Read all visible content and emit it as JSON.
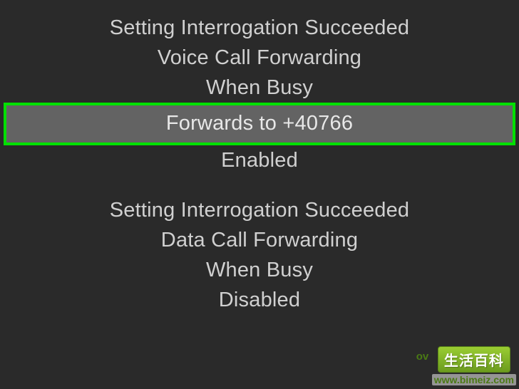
{
  "groups": [
    {
      "title": "Setting Interrogation Succeeded",
      "service": "Voice Call Forwarding",
      "condition": "When Busy",
      "forwards": "Forwards to +40766",
      "status": "Enabled"
    },
    {
      "title": "Setting Interrogation Succeeded",
      "service": "Data Call Forwarding",
      "condition": "When Busy",
      "status": "Disabled"
    }
  ],
  "watermark": {
    "label": "生活百科",
    "url": "www.bimeiz.com",
    "side_char": "ov"
  }
}
